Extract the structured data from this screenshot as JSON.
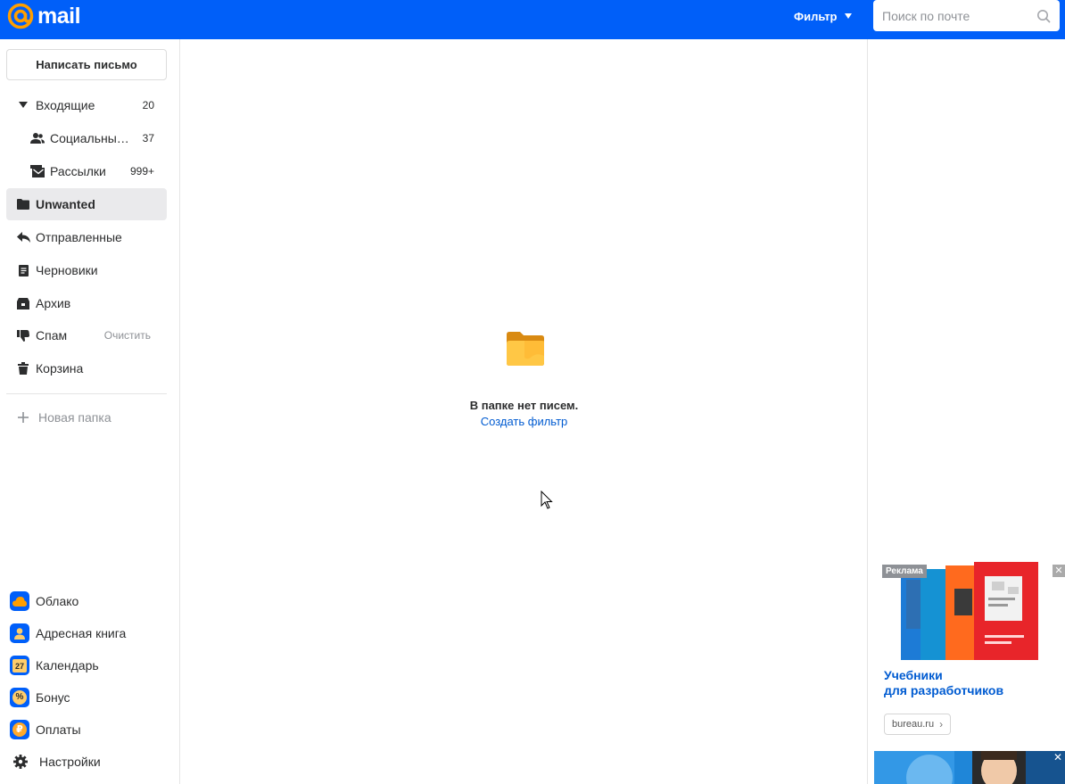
{
  "header": {
    "logo_text": "mail",
    "filter_label": "Фильтр",
    "search_placeholder": "Поиск по почте",
    "bg_color": "#005ff9"
  },
  "sidebar": {
    "compose_label": "Написать письмо",
    "folders": [
      {
        "label": "Входящие",
        "count": "20",
        "icon": "triangle-down-icon"
      },
      {
        "label": "Социальны…",
        "count": "37",
        "icon": "social-icon"
      },
      {
        "label": "Рассылки",
        "count": "999+",
        "icon": "newsletter-icon"
      },
      {
        "label": "Unwanted",
        "count": "",
        "icon": "folder-icon",
        "active": true
      },
      {
        "label": "Отправленные",
        "count": "",
        "icon": "reply-icon"
      },
      {
        "label": "Черновики",
        "count": "",
        "icon": "draft-icon"
      },
      {
        "label": "Архив",
        "count": "",
        "icon": "archive-icon"
      },
      {
        "label": "Спам",
        "action": "Очистить",
        "icon": "thumb-down-icon"
      },
      {
        "label": "Корзина",
        "count": "",
        "icon": "trash-icon"
      }
    ],
    "new_folder_label": "Новая папка",
    "apps": [
      {
        "label": "Облако",
        "icon": "cloud-icon"
      },
      {
        "label": "Адресная книга",
        "icon": "contacts-icon"
      },
      {
        "label": "Календарь",
        "icon": "calendar-icon",
        "badge": "27"
      },
      {
        "label": "Бонус",
        "icon": "bonus-icon",
        "badge": "%"
      },
      {
        "label": "Оплаты",
        "icon": "payments-icon",
        "badge": "₽"
      }
    ],
    "settings_label": "Настройки"
  },
  "main": {
    "empty_title": "В папке нет писем.",
    "empty_link": "Создать фильтр"
  },
  "ads": {
    "label": "Реклама",
    "close": "✕",
    "title_line1": "Учебники",
    "title_line2": "для разработчиков",
    "domain": "bureau.ru",
    "domain_chevron": "›"
  }
}
